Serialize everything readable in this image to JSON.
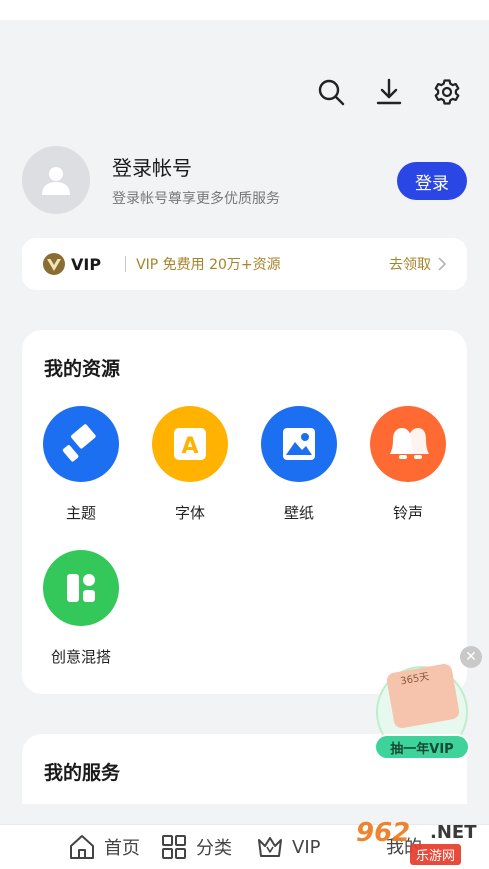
{
  "toolbar": {
    "icons": [
      "search-icon",
      "download-icon",
      "gear-icon"
    ]
  },
  "profile": {
    "title": "登录帐号",
    "subtitle": "登录帐号尊享更多优质服务",
    "login_label": "登录"
  },
  "vip_banner": {
    "logo_text": "VIP",
    "promo_text": "VIP 免费用 20万+资源",
    "claim_label": "去领取"
  },
  "resources": {
    "title": "我的资源",
    "items": [
      {
        "label": "主题",
        "icon": "brush-icon",
        "color": "#1d6ff2"
      },
      {
        "label": "字体",
        "icon": "font-icon",
        "color": "#ffb300"
      },
      {
        "label": "壁纸",
        "icon": "image-icon",
        "color": "#1d6ff2"
      },
      {
        "label": "铃声",
        "icon": "bell-icon",
        "color": "#ff6a32"
      },
      {
        "label": "创意混搭",
        "icon": "layout-icon",
        "color": "#34c759"
      }
    ]
  },
  "services": {
    "title": "我的服务"
  },
  "floating_promo": {
    "ticket_text": "365天",
    "label": "抽一年VIP"
  },
  "bottom_nav": {
    "items": [
      {
        "label": "首页",
        "icon": "home-icon"
      },
      {
        "label": "分类",
        "icon": "grid-icon"
      },
      {
        "label": "VIP",
        "icon": "crown-icon"
      },
      {
        "label": "我的",
        "icon": "user-icon"
      }
    ]
  },
  "watermark": {
    "number": "962",
    "suffix": ".NET",
    "sub": "乐游网"
  },
  "colors": {
    "accent": "#2a47e6",
    "vip_gold": "#a7842a",
    "background": "#f1f3f5"
  }
}
